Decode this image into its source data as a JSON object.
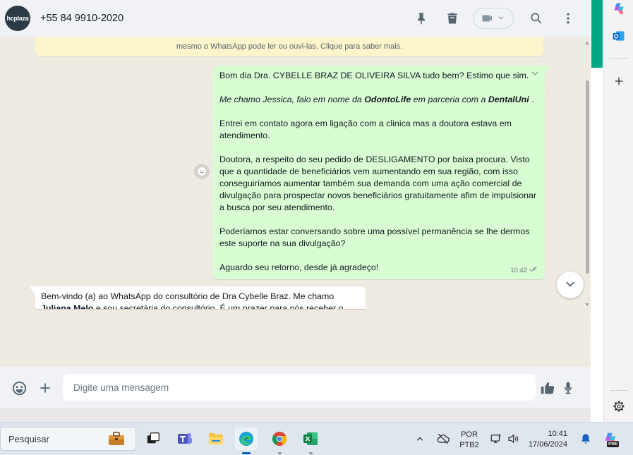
{
  "header": {
    "avatar_text": "hcplaza",
    "contact_name": "+55 84 9910-2020"
  },
  "encryption_note": "mesmo o WhatsApp pode ler ou ouvi-las. Clique para saber mais.",
  "outgoing_message": {
    "para1": "Bom dia Dra. CYBELLE BRAZ DE OLIVEIRA SILVA tudo bem? Estimo que sim.",
    "para2_a": "Me chamo Jessica, falo em nome da ",
    "para2_b": "OdontoLife",
    "para2_c": " em parceria com a ",
    "para2_d": "DentalUni",
    "para2_e": " .",
    "para3": "Entrei em contato agora em ligação com a clinica mas a doutora estava em atendimento.",
    "para4": "Doutora, a respeito do seu pedido de DESLIGAMENTO por baixa procura. Visto que a quantidade de beneficiários vem aumentando em sua região, com isso conseguiríamos aumentar também sua demanda com uma ação comercial de divulgação para prospectar novos beneficiários gratuitamente afim de impulsionar a busca por seu atendimento.",
    "para5": "Poderíamos estar conversando sobre uma possível permanência se lhe dermos este suporte na sua divulgação?",
    "para6": "Aguardo seu retorno, desde já agradeço!",
    "time": "10:42"
  },
  "incoming_message": {
    "line1": "Bem-vindo (a) ao WhatsApp do consultório de Dra Cybelle Braz. Me chamo",
    "line2_bold": "Juliana Melo",
    "line2_rest": " e sou secretária do consultório. É um prazer para nós receber o"
  },
  "composer": {
    "placeholder": "Digite uma mensagem"
  },
  "taskbar": {
    "search_placeholder": "Pesquisar",
    "lang_top": "POR",
    "lang_bottom": "PTB2",
    "time": "10:41",
    "date": "17/06/2024",
    "copilot_badge": "PRE"
  },
  "colors": {
    "whatsapp_green": "#00a884",
    "outgoing_bubble": "#d9fdd3",
    "chat_background": "#efeae2",
    "encryption_banner": "#fcf4cb"
  }
}
